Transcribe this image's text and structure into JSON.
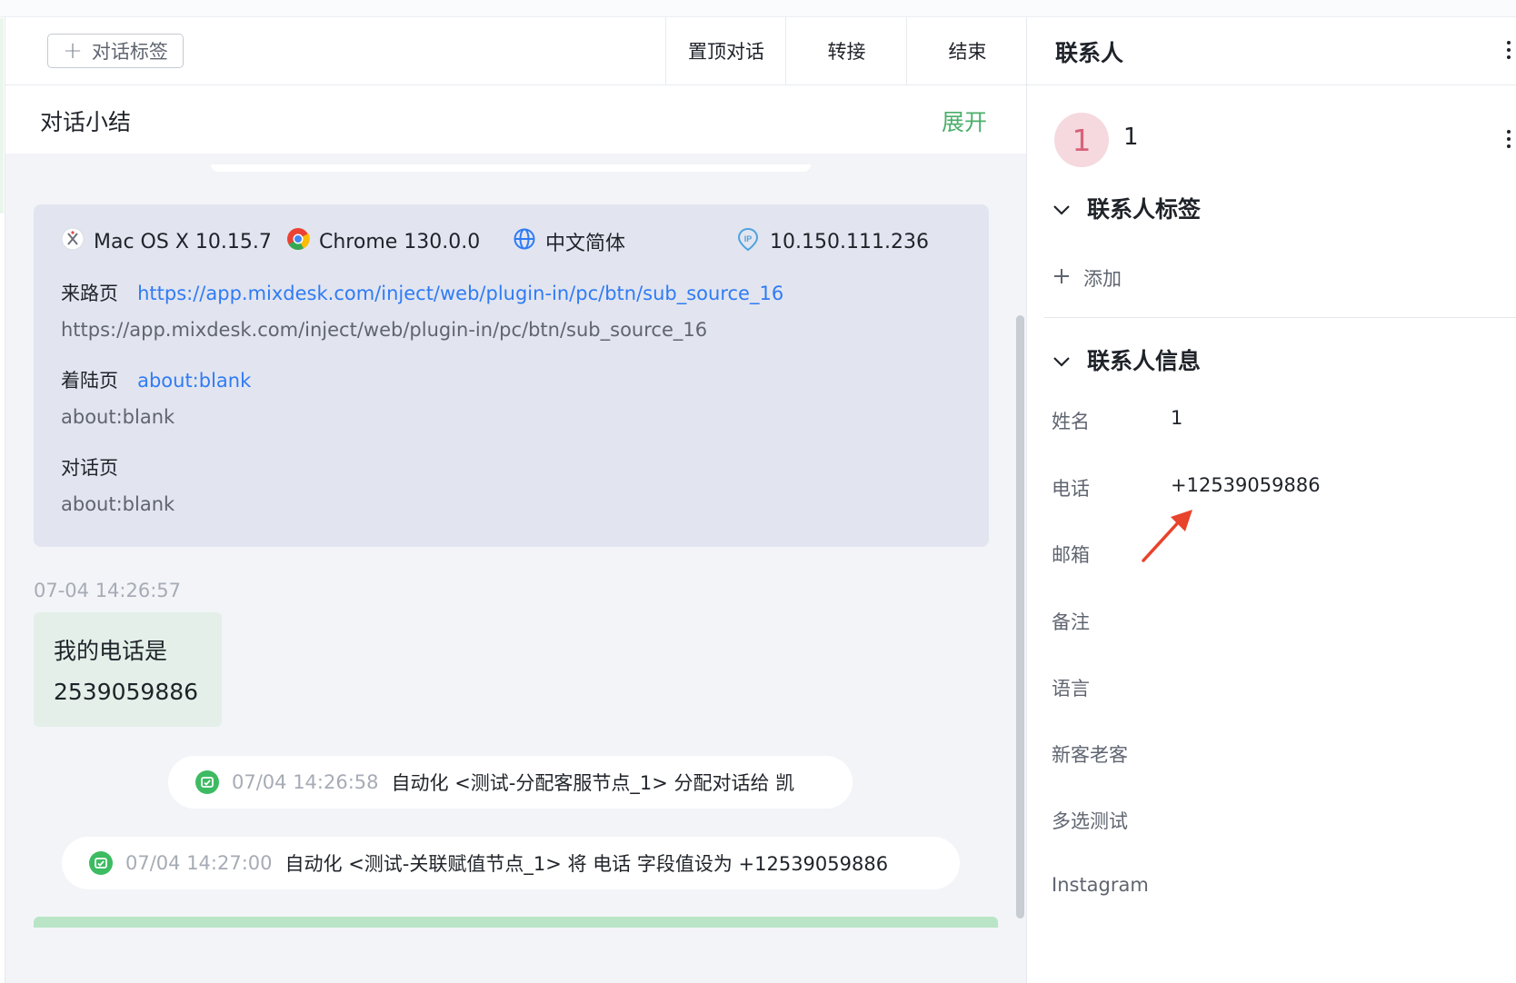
{
  "toolbar": {
    "tag_button_label": "对话标签",
    "pin_label": "置顶对话",
    "transfer_label": "转接",
    "end_label": "结束"
  },
  "summary": {
    "title": "对话小结",
    "expand_label": "展开"
  },
  "visitor_info": {
    "os": "Mac OS X 10.15.7",
    "browser": "Chrome 130.0.0",
    "language": "中文简体",
    "ip": "10.150.111.236",
    "source_label": "来路页",
    "source_link": "https://app.mixdesk.com/inject/web/plugin-in/pc/btn/sub_source_16",
    "source_text": "https://app.mixdesk.com/inject/web/plugin-in/pc/btn/sub_source_16",
    "landing_label": "着陆页",
    "landing_link": "about:blank",
    "landing_text": "about:blank",
    "chat_page_label": "对话页",
    "chat_page_text": "about:blank"
  },
  "messages": {
    "timestamp": "07-04 14:26:57",
    "customer_line1": "我的电话是",
    "customer_line2": "2539059886",
    "system_events": [
      {
        "time": "07/04 14:26:58",
        "text": "自动化 <测试-分配客服节点_1> 分配对话给 凯"
      },
      {
        "time": "07/04 14:27:00",
        "text": "自动化 <测试-关联赋值节点_1> 将 电话 字段值设为 +12539059886"
      }
    ]
  },
  "contact_panel": {
    "title": "联系人",
    "avatar_initial": "1",
    "name": "1",
    "tags_section_title": "联系人标签",
    "add_tag_label": "添加",
    "info_section_title": "联系人信息",
    "fields": [
      {
        "label": "姓名",
        "value": "1"
      },
      {
        "label": "电话",
        "value": "+12539059886"
      },
      {
        "label": "邮箱",
        "value": ""
      },
      {
        "label": "备注",
        "value": ""
      },
      {
        "label": "语言",
        "value": ""
      },
      {
        "label": "新客老客",
        "value": ""
      },
      {
        "label": "多选测试",
        "value": ""
      },
      {
        "label": "Instagram",
        "value": ""
      }
    ]
  },
  "colors": {
    "accent_green": "#4caf6b",
    "link_blue": "#2f7bf5",
    "annotation_arrow": "#e8432b",
    "avatar_bg": "#f5d9df"
  }
}
